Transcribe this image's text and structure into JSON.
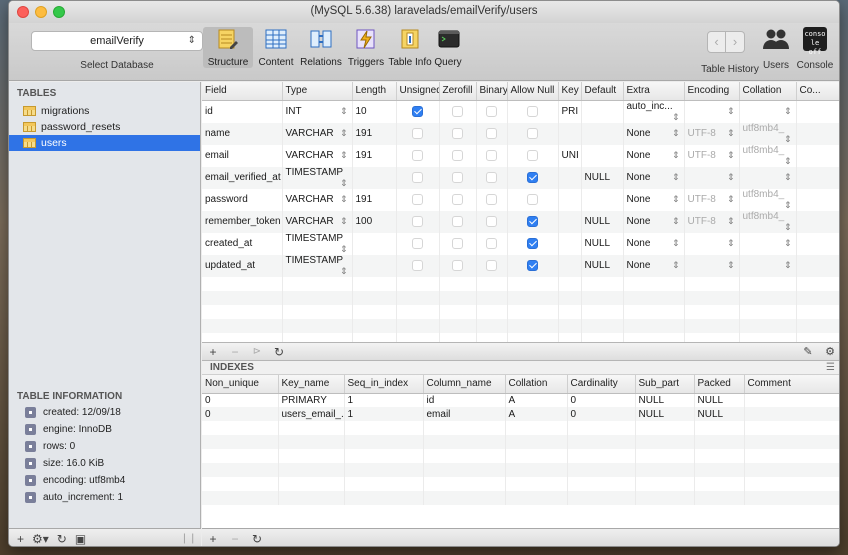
{
  "window": {
    "title": "(MySQL 5.6.38) laravelads/emailVerify/users"
  },
  "toolbar": {
    "database": "emailVerify",
    "database_caption": "Select Database",
    "tabs": [
      {
        "label": "Structure",
        "icon": "structure-icon"
      },
      {
        "label": "Content",
        "icon": "table-grid-icon"
      },
      {
        "label": "Relations",
        "icon": "relations-icon"
      },
      {
        "label": "Triggers",
        "icon": "triggers-icon"
      },
      {
        "label": "Table Info",
        "icon": "info-icon"
      },
      {
        "label": "Query",
        "icon": "terminal-icon"
      }
    ],
    "right": {
      "history": "Table History",
      "users": "Users",
      "console": "Console",
      "console_badge_top": "conso",
      "console_badge_bottom": "le off"
    }
  },
  "sidebar": {
    "tables_header": "TABLES",
    "tables": [
      "migrations",
      "password_resets",
      "users"
    ],
    "selected": "users",
    "info_header": "TABLE INFORMATION",
    "info": [
      "created: 12/09/18",
      "engine: InnoDB",
      "rows: 0",
      "size: 16.0 KiB",
      "encoding: utf8mb4",
      "auto_increment: 1"
    ]
  },
  "structure": {
    "columns": [
      "Field",
      "Type",
      "Length",
      "Unsigned",
      "Zerofill",
      "Binary",
      "Allow Null",
      "Key",
      "Default",
      "Extra",
      "Encoding",
      "Collation",
      "Co..."
    ],
    "rows": [
      {
        "field": "id",
        "type": "INT",
        "length": "10",
        "unsigned": true,
        "zerofill": false,
        "binary": false,
        "allow_null": false,
        "key": "PRI",
        "default": "",
        "extra": "auto_inc...",
        "encoding": "",
        "collation": ""
      },
      {
        "field": "name",
        "type": "VARCHAR",
        "length": "191",
        "unsigned": false,
        "zerofill": false,
        "binary": false,
        "allow_null": false,
        "key": "",
        "default": "",
        "extra": "None",
        "encoding": "UTF-8",
        "collation": "utf8mb4_"
      },
      {
        "field": "email",
        "type": "VARCHAR",
        "length": "191",
        "unsigned": false,
        "zerofill": false,
        "binary": false,
        "allow_null": false,
        "key": "UNI",
        "default": "",
        "extra": "None",
        "encoding": "UTF-8",
        "collation": "utf8mb4_"
      },
      {
        "field": "email_verified_at",
        "type": "TIMESTAMP",
        "length": "",
        "unsigned": false,
        "zerofill": false,
        "binary": false,
        "allow_null": true,
        "key": "",
        "default": "NULL",
        "extra": "None",
        "encoding": "",
        "collation": ""
      },
      {
        "field": "password",
        "type": "VARCHAR",
        "length": "191",
        "unsigned": false,
        "zerofill": false,
        "binary": false,
        "allow_null": false,
        "key": "",
        "default": "",
        "extra": "None",
        "encoding": "UTF-8",
        "collation": "utf8mb4_"
      },
      {
        "field": "remember_token",
        "type": "VARCHAR",
        "length": "100",
        "unsigned": false,
        "zerofill": false,
        "binary": false,
        "allow_null": true,
        "key": "",
        "default": "NULL",
        "extra": "None",
        "encoding": "UTF-8",
        "collation": "utf8mb4_"
      },
      {
        "field": "created_at",
        "type": "TIMESTAMP",
        "length": "",
        "unsigned": false,
        "zerofill": false,
        "binary": false,
        "allow_null": true,
        "key": "",
        "default": "NULL",
        "extra": "None",
        "encoding": "",
        "collation": ""
      },
      {
        "field": "updated_at",
        "type": "TIMESTAMP",
        "length": "",
        "unsigned": false,
        "zerofill": false,
        "binary": false,
        "allow_null": true,
        "key": "",
        "default": "NULL",
        "extra": "None",
        "encoding": "",
        "collation": ""
      }
    ]
  },
  "indexes": {
    "header": "INDEXES",
    "columns": [
      "Non_unique",
      "Key_name",
      "Seq_in_index",
      "Column_name",
      "Collation",
      "Cardinality",
      "Sub_part",
      "Packed",
      "Comment"
    ],
    "rows": [
      [
        "0",
        "PRIMARY",
        "1",
        "id",
        "A",
        "0",
        "NULL",
        "NULL",
        ""
      ],
      [
        "0",
        "users_email_...",
        "1",
        "email",
        "A",
        "0",
        "NULL",
        "NULL",
        ""
      ]
    ]
  },
  "colors": {
    "accent": "#2f73e6",
    "checkbox_on": "#2f7ff2"
  }
}
